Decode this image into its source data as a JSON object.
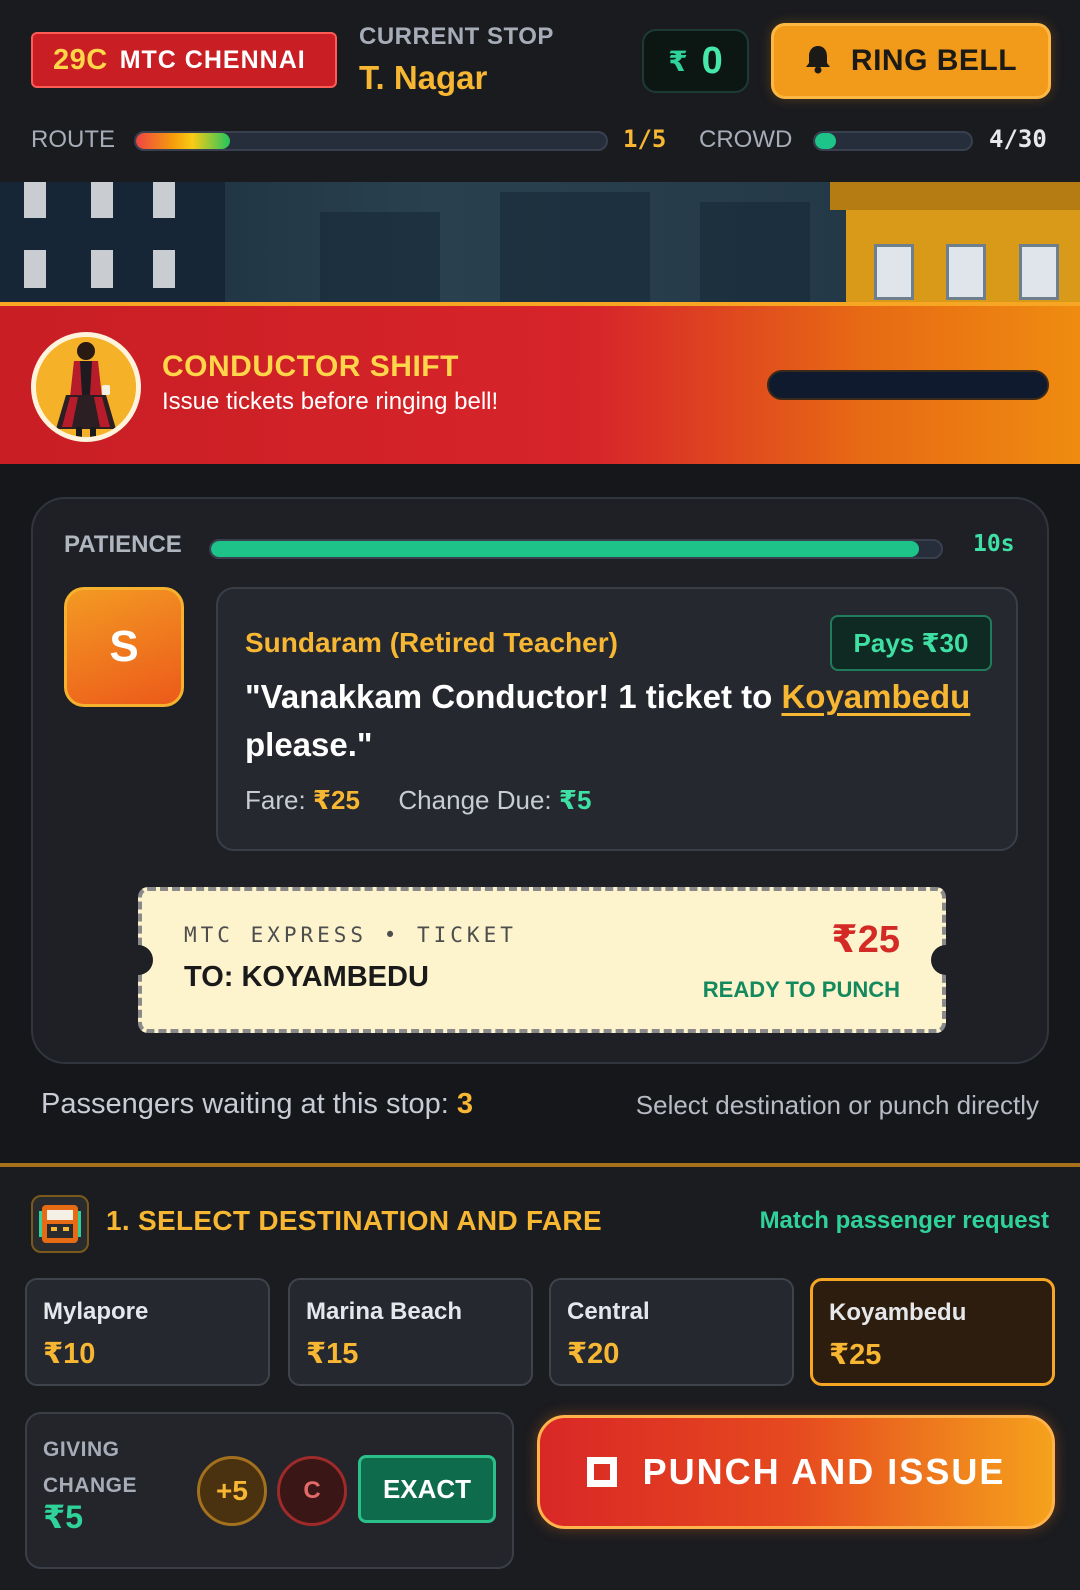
{
  "header": {
    "route_number": "29C",
    "operator": "MTC CHENNAI",
    "stop_label": "CURRENT STOP",
    "stop_name": "T. Nagar",
    "currency_symbol": "₹",
    "earnings": "0",
    "ring_bell_label": "RING BELL",
    "route_label": "ROUTE",
    "route_count": "1/5",
    "route_progress": 0.2,
    "crowd_label": "CROWD",
    "crowd_count": "4/30",
    "crowd_progress": 0.133
  },
  "banner": {
    "title": "CONDUCTOR SHIFT",
    "subtitle": "Issue tickets before ringing bell!",
    "shift_progress": 0
  },
  "passenger": {
    "patience_label": "PATIENCE",
    "patience_time": "10s",
    "patience_fraction": 0.97,
    "avatar_letter": "S",
    "name": "Sundaram (Retired Teacher)",
    "pays": "Pays ₹30",
    "quote_start": "\"Vanakkam Conductor! 1 ticket to ",
    "quote_dest": "Koyambedu",
    "quote_end": " please.\"",
    "fare_label": "Fare:",
    "fare_value": "₹25",
    "change_label": "Change Due:",
    "change_value": "₹5"
  },
  "ticket": {
    "header": "MTC EXPRESS • TICKET",
    "destination": "TO: KOYAMBEDU",
    "price": "₹25",
    "status": "READY TO PUNCH"
  },
  "status": {
    "waiting_label": "Passengers waiting at this stop:",
    "waiting_count": "3",
    "hint": "Select destination or punch directly"
  },
  "destinations": {
    "section_title": "1. SELECT DESTINATION AND FARE",
    "section_hint": "Match passenger request",
    "items": [
      {
        "name": "Mylapore",
        "price": "₹10",
        "selected": false
      },
      {
        "name": "Marina Beach",
        "price": "₹15",
        "selected": false
      },
      {
        "name": "Central",
        "price": "₹20",
        "selected": false
      },
      {
        "name": "Koyambedu",
        "price": "₹25",
        "selected": true
      }
    ]
  },
  "change": {
    "label": "GIVING CHANGE",
    "value": "₹5",
    "plus_label": "+5",
    "clear_label": "C",
    "exact_label": "EXACT"
  },
  "punch": {
    "label": "PUNCH AND ISSUE"
  },
  "colors": {
    "accent_yellow": "#f7b733",
    "accent_green": "#2fd39a",
    "accent_red": "#c81e24",
    "accent_orange": "#f29a1a"
  }
}
